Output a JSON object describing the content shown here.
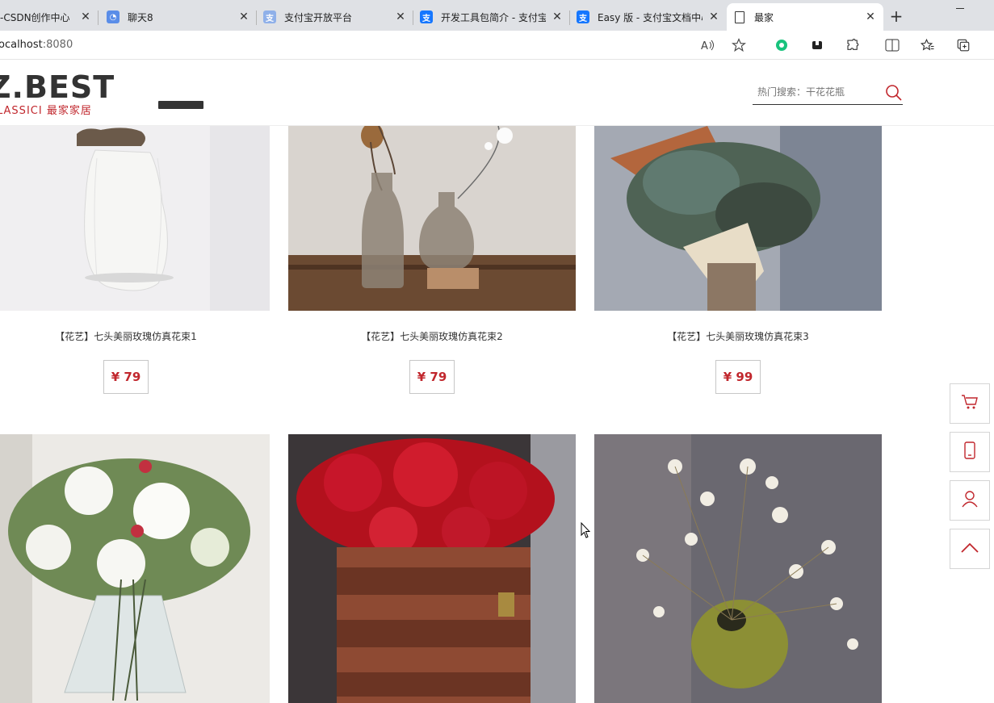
{
  "browser": {
    "tabs": [
      {
        "label": "-CSDN创作中心",
        "icon": "csdn-icon"
      },
      {
        "label": "聊天8",
        "icon": "chat-icon"
      },
      {
        "label": "支付宝开放平台",
        "icon": "alipay-icon"
      },
      {
        "label": "开发工具包简介 - 支付宝",
        "icon": "alipay-icon"
      },
      {
        "label": "Easy 版 - 支付宝文档中心",
        "icon": "alipay-icon"
      },
      {
        "label": "最家",
        "icon": "page-icon"
      }
    ],
    "url_host": "ocalhost",
    "url_port": ":8080"
  },
  "site": {
    "logo_main": "Z.BEST",
    "logo_sub": "LASSICI 最家家居",
    "search_placeholder": "热门搜索：干花花瓶",
    "brand_color": "#c1272d"
  },
  "products": [
    {
      "title": "【花艺】七头美丽玫瑰仿真花束1",
      "price": "¥ 79"
    },
    {
      "title": "【花艺】七头美丽玫瑰仿真花束2",
      "price": "¥ 79"
    },
    {
      "title": "【花艺】七头美丽玫瑰仿真花束3",
      "price": "¥ 99"
    }
  ],
  "sidebar": [
    "cart-icon",
    "phone-icon",
    "user-icon",
    "back-to-top-icon"
  ]
}
